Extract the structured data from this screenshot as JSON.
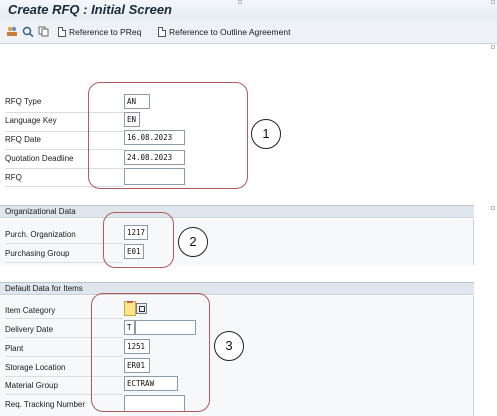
{
  "title": "Create RFQ : Initial Screen",
  "toolbar": {
    "ref_preq": "Reference to PReq",
    "ref_outline": "Reference to Outline Agreement"
  },
  "rfq": {
    "rfq_type_label": "RFQ Type",
    "rfq_type_value": "AN",
    "language_key_label": "Language Key",
    "language_key_value": "EN",
    "rfq_date_label": "RFQ Date",
    "rfq_date_value": "16.08.2023",
    "quotation_deadline_label": "Quotation Deadline",
    "quotation_deadline_value": "24.08.2023",
    "rfq_label": "RFQ",
    "rfq_value": ""
  },
  "org": {
    "section_title": "Organizational Data",
    "purch_org_label": "Purch. Organization",
    "purch_org_value": "1217",
    "purch_group_label": "Purchasing Group",
    "purch_group_value": "E01"
  },
  "defaults": {
    "section_title": "Default Data for Items",
    "item_category_label": "Item Category",
    "item_category_value": "",
    "delivery_date_label": "Delivery Date",
    "delivery_date_type": "T",
    "delivery_date_value": "",
    "plant_label": "Plant",
    "plant_value": "1251",
    "storage_location_label": "Storage Location",
    "storage_location_value": "ER01",
    "material_group_label": "Material Group",
    "material_group_value": "ECTRAW",
    "req_tracking_label": "Req. Tracking Number",
    "req_tracking_value": ""
  },
  "annotations": [
    "1",
    "2",
    "3"
  ],
  "colors": {
    "highlight": "#b35a5a",
    "section_header": "#dfe6ed"
  }
}
